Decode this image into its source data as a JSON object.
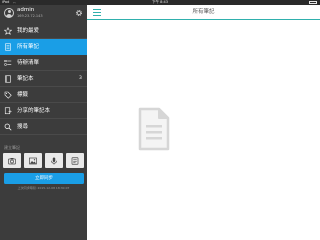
{
  "status_bar": {
    "carrier": "iPad",
    "time": "下午 8:43"
  },
  "user": {
    "name": "admin",
    "ip": "169.23.72.143"
  },
  "nav": {
    "items": [
      {
        "label": "我的最爱",
        "icon": "star-icon"
      },
      {
        "label": "所有筆記",
        "icon": "notes-icon",
        "active": true
      },
      {
        "label": "待辦清單",
        "icon": "todo-icon"
      },
      {
        "label": "筆記本",
        "icon": "notebook-icon",
        "count": "3"
      },
      {
        "label": "標籤",
        "icon": "tag-icon"
      },
      {
        "label": "分享的筆記本",
        "icon": "shared-notebook-icon"
      },
      {
        "label": "搜尋",
        "icon": "search-icon"
      }
    ]
  },
  "quick_note": {
    "label": "建立筆記",
    "buttons": [
      "camera-icon",
      "image-icon",
      "microphone-icon",
      "note-icon"
    ]
  },
  "sync": {
    "button_label": "立即同步",
    "last_sync": "上次同步時間: 2015-12-08 18:30:07"
  },
  "main": {
    "title": "所有筆記",
    "menu_icon": "hamburger-menu-icon",
    "empty_icon": "empty-document-icon"
  },
  "colors": {
    "accent": "#1a9ee6",
    "sidebar_bg": "#3c3c3c",
    "topbar_line": "#2fb0ad"
  }
}
